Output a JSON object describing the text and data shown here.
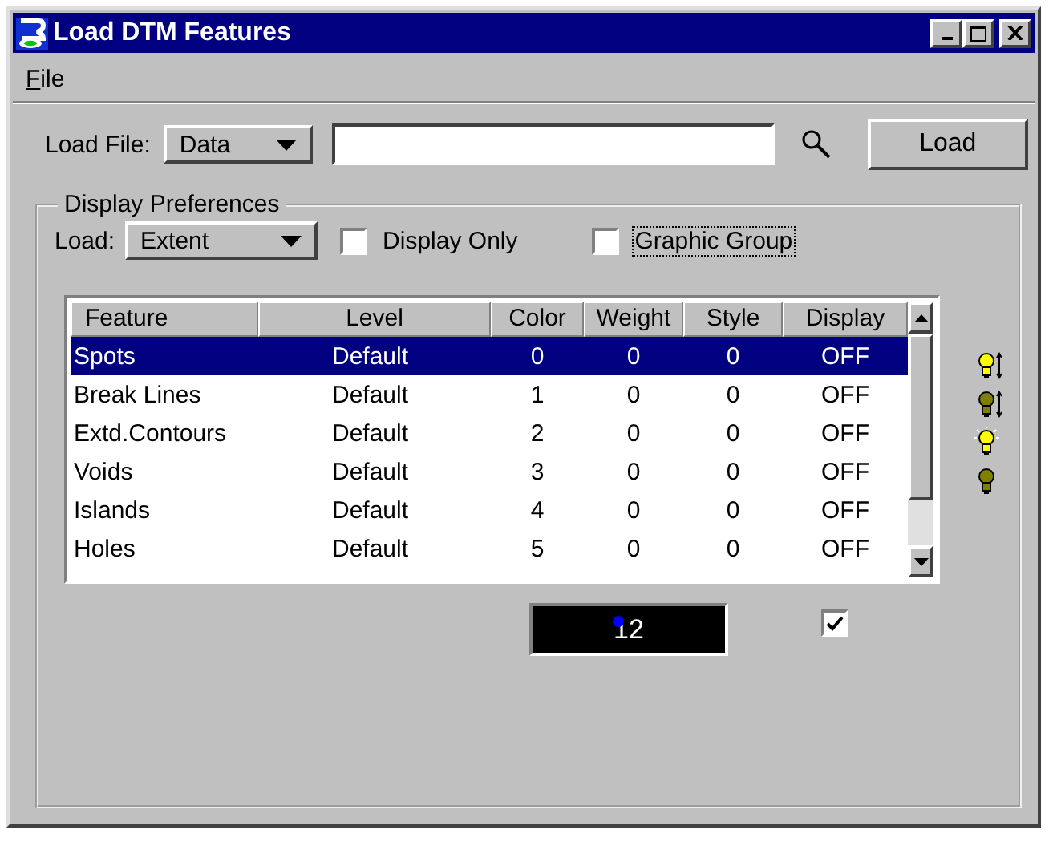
{
  "window": {
    "title": "Load DTM Features"
  },
  "menu": [
    {
      "label": "File"
    }
  ],
  "load_file": {
    "label": "Load File:",
    "type": "Data",
    "button": "Load"
  },
  "display_preferences": {
    "title": "Display Preferences",
    "load_label": "Load:",
    "load_value": "Extent",
    "checkboxes": [
      {
        "label": "Display Only",
        "checked": false,
        "focused": false
      },
      {
        "label": "Graphic Group",
        "checked": false,
        "focused": true
      }
    ]
  },
  "table": {
    "columns": [
      "Feature",
      "Level",
      "Color",
      "Weight",
      "Style",
      "Display"
    ],
    "rows": [
      {
        "cells": [
          "Spots",
          "Default",
          "0",
          "0",
          "0",
          "OFF"
        ],
        "selected": true
      },
      {
        "cells": [
          "Break Lines",
          "Default",
          "1",
          "0",
          "0",
          "OFF"
        ],
        "selected": false
      },
      {
        "cells": [
          "Extd.Contours",
          "Default",
          "2",
          "0",
          "0",
          "OFF"
        ],
        "selected": false
      },
      {
        "cells": [
          "Voids",
          "Default",
          "3",
          "0",
          "0",
          "OFF"
        ],
        "selected": false
      },
      {
        "cells": [
          "Islands",
          "Default",
          "4",
          "0",
          "0",
          "OFF"
        ],
        "selected": false
      },
      {
        "cells": [
          "Holes",
          "Default",
          "5",
          "0",
          "0",
          "OFF"
        ],
        "selected": false
      }
    ]
  },
  "color_value": "12",
  "display_checkbox": {
    "checked": true
  }
}
